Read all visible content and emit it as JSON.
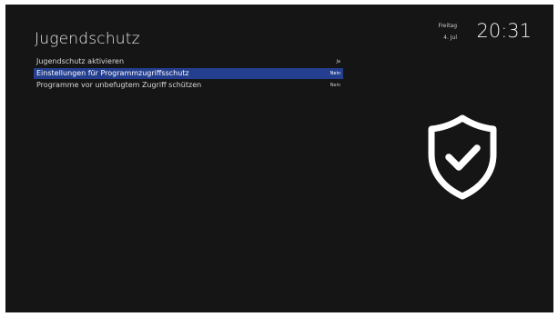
{
  "header": {
    "title": "Jugendschutz"
  },
  "clock": {
    "day": "Freitag",
    "date": "4. Jul",
    "time": "20:31"
  },
  "menu": {
    "items": [
      {
        "label": "Jugendschutz aktivieren",
        "value": "Ja",
        "selected": false
      },
      {
        "label": "Einstellungen für Programmzugriffsschutz",
        "value": "Nein",
        "selected": true
      },
      {
        "label": "Programme vor unbefugtem Zugriff schützen",
        "value": "Nein",
        "selected": false
      }
    ]
  },
  "icon": {
    "name": "shield-check-icon"
  },
  "colors": {
    "background": "#151515",
    "highlight": "#243f8f",
    "text": "#d8d8d8"
  }
}
